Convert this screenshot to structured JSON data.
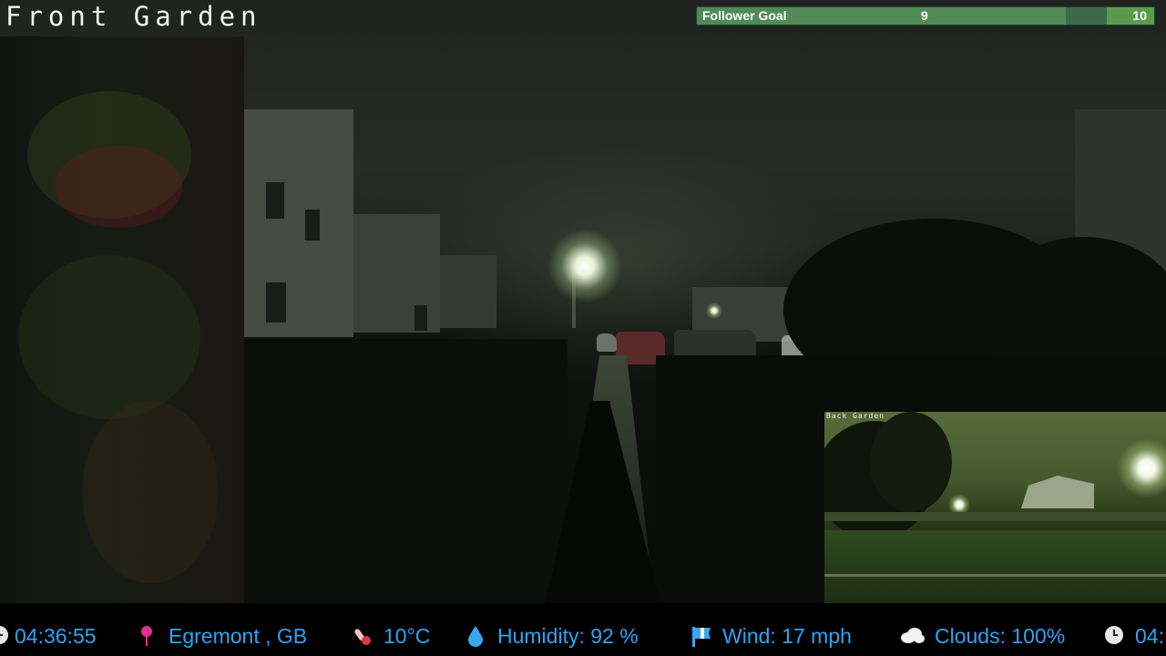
{
  "main_camera": {
    "title": "Front Garden"
  },
  "follower_goal": {
    "label": "Follower Goal",
    "current": "9",
    "target": "10",
    "progress": 0.9,
    "fill_color": "#4f8a57",
    "track_color": "#3e6a4a",
    "target_color": "#5b9b4e"
  },
  "pip_camera": {
    "title": "Back Garden"
  },
  "ticker": {
    "accent_color": "#2fa3f2",
    "items": [
      {
        "icon": "clock-icon",
        "text": "04:36:55"
      },
      {
        "icon": "location-pin-icon",
        "text": "Egremont , GB"
      },
      {
        "icon": "thermometer-icon",
        "text": "10°C"
      },
      {
        "icon": "water-drop-icon",
        "text": "Humidity: 92 %"
      },
      {
        "icon": "windsock-icon",
        "text": "Wind: 17 mph"
      },
      {
        "icon": "cloud-icon",
        "text": "Clouds: 100%"
      },
      {
        "icon": "clock-icon",
        "text": "04:"
      }
    ]
  }
}
